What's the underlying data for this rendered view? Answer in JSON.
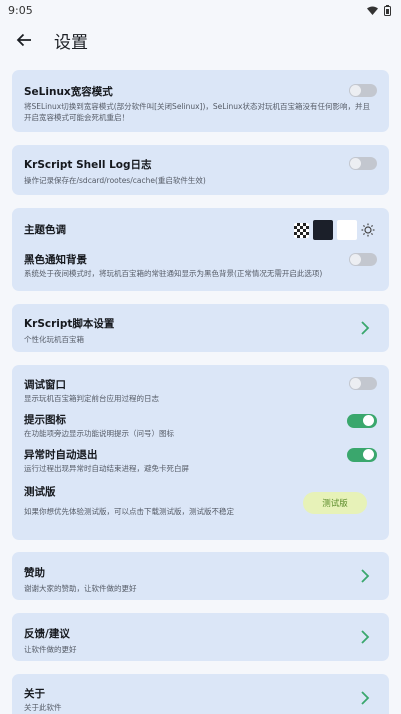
{
  "status": {
    "time": "9:05"
  },
  "appbar": {
    "title": "设置"
  },
  "selinux": {
    "title": "SeLinux宽容模式",
    "desc": "将SELinux切换到宽容模式(部分软件叫[关闭Selinux])，SeLinux状态对玩机百宝箱没有任何影响，并且开启宽容模式可能会死机重启！",
    "enabled": false
  },
  "krlog": {
    "title": "KrScript Shell Log日志",
    "desc": "操作记录保存在/sdcard/rootes/cache(重启软件生效)",
    "enabled": false
  },
  "theme": {
    "title": "主题色调",
    "black_notif_title": "黑色通知背景",
    "black_notif_desc": "系统处于夜间模式时，将玩机百宝箱的常驻通知显示为黑色背景(正常情况无需开启此选项)",
    "black_notif_enabled": false
  },
  "krscript": {
    "title": "KrScript脚本设置",
    "desc": "个性化玩机百宝箱"
  },
  "debug": {
    "title": "调试窗口",
    "desc": "显示玩机百宝箱判定前台应用过程的日志",
    "enabled": false
  },
  "hint_icon": {
    "title": "提示图标",
    "desc": "在功能项旁边显示功能说明提示（问号）图标",
    "enabled": true
  },
  "auto_exit": {
    "title": "异常时自动退出",
    "desc": "运行过程出现异常时自动结束进程，避免卡死白屏",
    "enabled": true
  },
  "beta": {
    "title": "测试版",
    "desc": "如果你想优先体验测试版，可以点击下载测试版，测试版不稳定",
    "button": "测试版"
  },
  "donate": {
    "title": "赞助",
    "desc": "谢谢大家的赞助，让软件做的更好"
  },
  "feedback": {
    "title": "反馈/建议",
    "desc": "让软件做的更好"
  },
  "about": {
    "title": "关于",
    "desc": "关于此软件"
  },
  "colors": {
    "accent": "#3aa76d",
    "card": "#dbe6f7",
    "background": "#f5f7fb",
    "beta_button": "#e7f2b8"
  }
}
